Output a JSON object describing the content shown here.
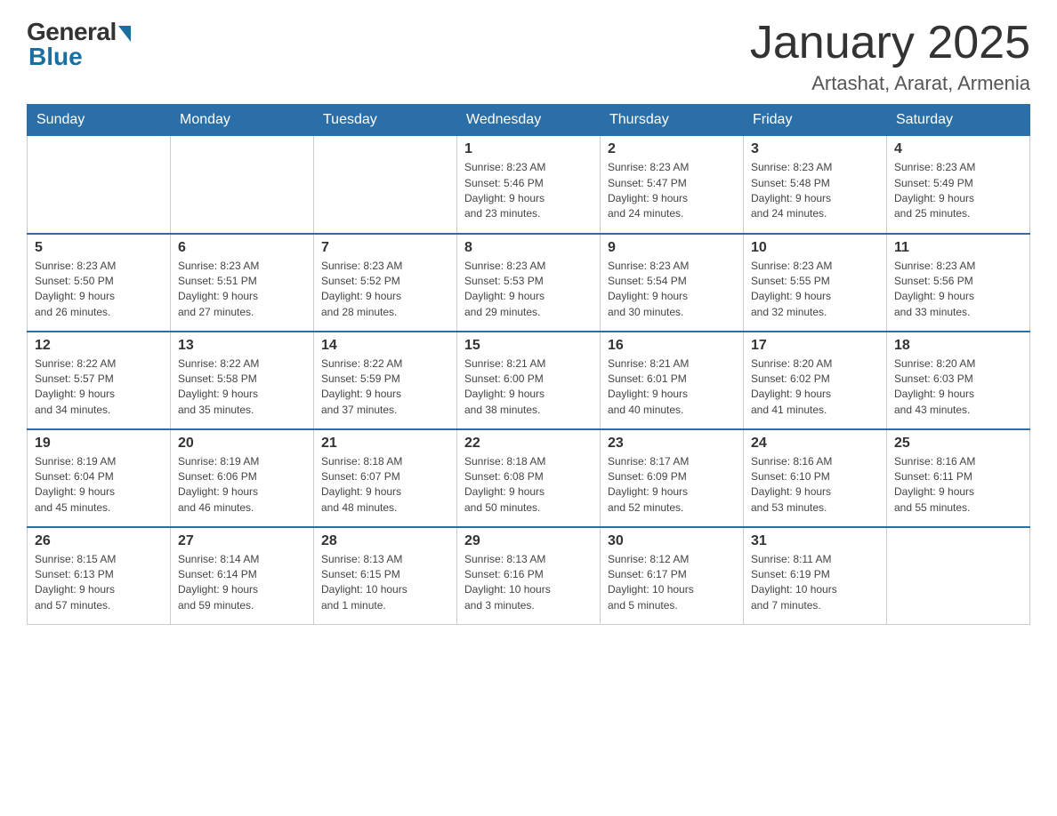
{
  "logo": {
    "general": "General",
    "blue": "Blue"
  },
  "header": {
    "month": "January 2025",
    "location": "Artashat, Ararat, Armenia"
  },
  "days": [
    "Sunday",
    "Monday",
    "Tuesday",
    "Wednesday",
    "Thursday",
    "Friday",
    "Saturday"
  ],
  "weeks": [
    [
      {
        "day": "",
        "info": ""
      },
      {
        "day": "",
        "info": ""
      },
      {
        "day": "",
        "info": ""
      },
      {
        "day": "1",
        "info": "Sunrise: 8:23 AM\nSunset: 5:46 PM\nDaylight: 9 hours\nand 23 minutes."
      },
      {
        "day": "2",
        "info": "Sunrise: 8:23 AM\nSunset: 5:47 PM\nDaylight: 9 hours\nand 24 minutes."
      },
      {
        "day": "3",
        "info": "Sunrise: 8:23 AM\nSunset: 5:48 PM\nDaylight: 9 hours\nand 24 minutes."
      },
      {
        "day": "4",
        "info": "Sunrise: 8:23 AM\nSunset: 5:49 PM\nDaylight: 9 hours\nand 25 minutes."
      }
    ],
    [
      {
        "day": "5",
        "info": "Sunrise: 8:23 AM\nSunset: 5:50 PM\nDaylight: 9 hours\nand 26 minutes."
      },
      {
        "day": "6",
        "info": "Sunrise: 8:23 AM\nSunset: 5:51 PM\nDaylight: 9 hours\nand 27 minutes."
      },
      {
        "day": "7",
        "info": "Sunrise: 8:23 AM\nSunset: 5:52 PM\nDaylight: 9 hours\nand 28 minutes."
      },
      {
        "day": "8",
        "info": "Sunrise: 8:23 AM\nSunset: 5:53 PM\nDaylight: 9 hours\nand 29 minutes."
      },
      {
        "day": "9",
        "info": "Sunrise: 8:23 AM\nSunset: 5:54 PM\nDaylight: 9 hours\nand 30 minutes."
      },
      {
        "day": "10",
        "info": "Sunrise: 8:23 AM\nSunset: 5:55 PM\nDaylight: 9 hours\nand 32 minutes."
      },
      {
        "day": "11",
        "info": "Sunrise: 8:23 AM\nSunset: 5:56 PM\nDaylight: 9 hours\nand 33 minutes."
      }
    ],
    [
      {
        "day": "12",
        "info": "Sunrise: 8:22 AM\nSunset: 5:57 PM\nDaylight: 9 hours\nand 34 minutes."
      },
      {
        "day": "13",
        "info": "Sunrise: 8:22 AM\nSunset: 5:58 PM\nDaylight: 9 hours\nand 35 minutes."
      },
      {
        "day": "14",
        "info": "Sunrise: 8:22 AM\nSunset: 5:59 PM\nDaylight: 9 hours\nand 37 minutes."
      },
      {
        "day": "15",
        "info": "Sunrise: 8:21 AM\nSunset: 6:00 PM\nDaylight: 9 hours\nand 38 minutes."
      },
      {
        "day": "16",
        "info": "Sunrise: 8:21 AM\nSunset: 6:01 PM\nDaylight: 9 hours\nand 40 minutes."
      },
      {
        "day": "17",
        "info": "Sunrise: 8:20 AM\nSunset: 6:02 PM\nDaylight: 9 hours\nand 41 minutes."
      },
      {
        "day": "18",
        "info": "Sunrise: 8:20 AM\nSunset: 6:03 PM\nDaylight: 9 hours\nand 43 minutes."
      }
    ],
    [
      {
        "day": "19",
        "info": "Sunrise: 8:19 AM\nSunset: 6:04 PM\nDaylight: 9 hours\nand 45 minutes."
      },
      {
        "day": "20",
        "info": "Sunrise: 8:19 AM\nSunset: 6:06 PM\nDaylight: 9 hours\nand 46 minutes."
      },
      {
        "day": "21",
        "info": "Sunrise: 8:18 AM\nSunset: 6:07 PM\nDaylight: 9 hours\nand 48 minutes."
      },
      {
        "day": "22",
        "info": "Sunrise: 8:18 AM\nSunset: 6:08 PM\nDaylight: 9 hours\nand 50 minutes."
      },
      {
        "day": "23",
        "info": "Sunrise: 8:17 AM\nSunset: 6:09 PM\nDaylight: 9 hours\nand 52 minutes."
      },
      {
        "day": "24",
        "info": "Sunrise: 8:16 AM\nSunset: 6:10 PM\nDaylight: 9 hours\nand 53 minutes."
      },
      {
        "day": "25",
        "info": "Sunrise: 8:16 AM\nSunset: 6:11 PM\nDaylight: 9 hours\nand 55 minutes."
      }
    ],
    [
      {
        "day": "26",
        "info": "Sunrise: 8:15 AM\nSunset: 6:13 PM\nDaylight: 9 hours\nand 57 minutes."
      },
      {
        "day": "27",
        "info": "Sunrise: 8:14 AM\nSunset: 6:14 PM\nDaylight: 9 hours\nand 59 minutes."
      },
      {
        "day": "28",
        "info": "Sunrise: 8:13 AM\nSunset: 6:15 PM\nDaylight: 10 hours\nand 1 minute."
      },
      {
        "day": "29",
        "info": "Sunrise: 8:13 AM\nSunset: 6:16 PM\nDaylight: 10 hours\nand 3 minutes."
      },
      {
        "day": "30",
        "info": "Sunrise: 8:12 AM\nSunset: 6:17 PM\nDaylight: 10 hours\nand 5 minutes."
      },
      {
        "day": "31",
        "info": "Sunrise: 8:11 AM\nSunset: 6:19 PM\nDaylight: 10 hours\nand 7 minutes."
      },
      {
        "day": "",
        "info": ""
      }
    ]
  ]
}
